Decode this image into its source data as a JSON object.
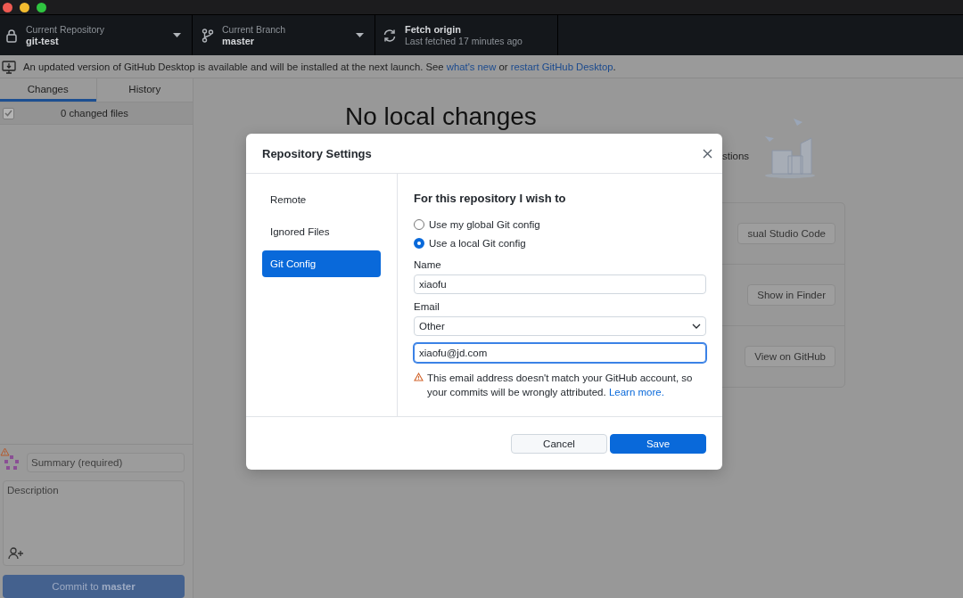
{
  "toolbar": [
    {
      "kind": "repository",
      "label": "Current Repository",
      "value": "git-test"
    },
    {
      "kind": "branch",
      "label": "Current Branch",
      "value": "master"
    },
    {
      "kind": "fetch",
      "label": "Fetch origin",
      "value": "Last fetched 17 minutes ago"
    }
  ],
  "banner": {
    "segments": [
      {
        "kind": "text",
        "text": "An updated version of GitHub Desktop is available and will be installed at the next launch. See"
      },
      {
        "kind": "link",
        "text": "what's new"
      },
      {
        "kind": "text",
        "text": "or"
      },
      {
        "kind": "link",
        "text": "restart GitHub Desktop"
      },
      {
        "kind": "end",
        "text": "."
      }
    ]
  },
  "sidebar": {
    "tabs": [
      {
        "label": "Changes",
        "selected": true
      },
      {
        "label": "History",
        "selected": false
      }
    ],
    "files": {
      "label": "0 changed files",
      "checked": true
    },
    "commit": {
      "summary": {
        "placeholder": "Summary (required)"
      },
      "description": {
        "placeholder": "Description"
      },
      "button": "Commit to **master**"
    }
  },
  "main": {
    "heading": "No local changes",
    "suggestion": "stions",
    "actions": [
      {
        "button": "sual Studio Code"
      },
      {
        "button": "Show in Finder"
      },
      {
        "button": "View on GitHub"
      }
    ]
  },
  "dialog": {
    "title": "Repository Settings",
    "nav": [
      {
        "label": "Remote",
        "selected": false
      },
      {
        "label": "Ignored Files",
        "selected": false
      },
      {
        "label": "Git Config",
        "selected": true
      }
    ],
    "heading": "For this repository I wish to",
    "options": [
      {
        "label": "Use my global Git config",
        "selected": false
      },
      {
        "label": "Use a local Git config",
        "selected": true
      }
    ],
    "name": {
      "label": "Name",
      "value": "xiaofu"
    },
    "email": {
      "label": "Email",
      "choice": "Other",
      "value": "xiaofu@jd.com"
    },
    "warning": {
      "text": "This email address doesn't match your GitHub account, so your commits will be wrongly attributed.",
      "link": "Learn more."
    },
    "buttons": [
      {
        "kind": "secondary",
        "label": "Cancel"
      },
      {
        "kind": "primary",
        "label": "Save"
      }
    ]
  }
}
